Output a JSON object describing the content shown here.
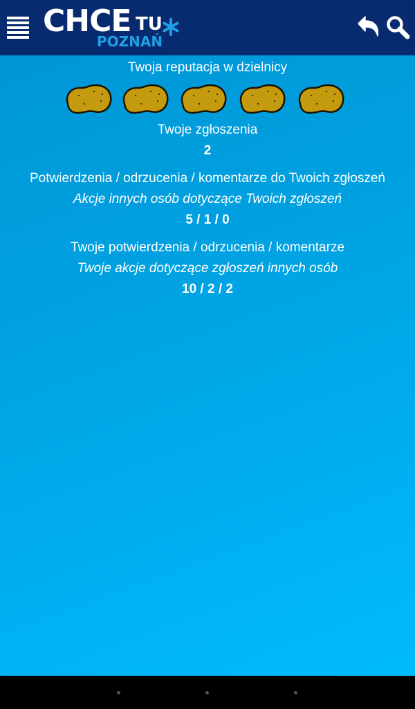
{
  "header": {
    "logo_main": "CHCE",
    "logo_tu": "TU",
    "logo_city": "POZNAŃ",
    "brand_color": "#082a6e",
    "accent_color": "#1ea0e6",
    "icons": [
      "menu-icon",
      "back-icon",
      "search-icon"
    ]
  },
  "profile": {
    "reputation_label": "Twoja reputacja w dzielnicy",
    "reputation_rating": 5,
    "reputation_max": 5,
    "reports_label": "Twoje zgłoszenia",
    "reports_value": "2",
    "others_actions_label": "Potwierdzenia / odrzucenia / komentarze do Twoich zgłoszeń",
    "others_actions_sublabel": "Akcje innych osób dotyczące Twoich zgłoszeń",
    "others_actions_value": "5 / 1 / 0",
    "my_actions_label": "Twoje potwierdzenia / odrzucenia / komentarze",
    "my_actions_sublabel": "Twoje akcje dotyczące zgłoszeń innych osób",
    "my_actions_value": "10 / 2 / 2"
  }
}
